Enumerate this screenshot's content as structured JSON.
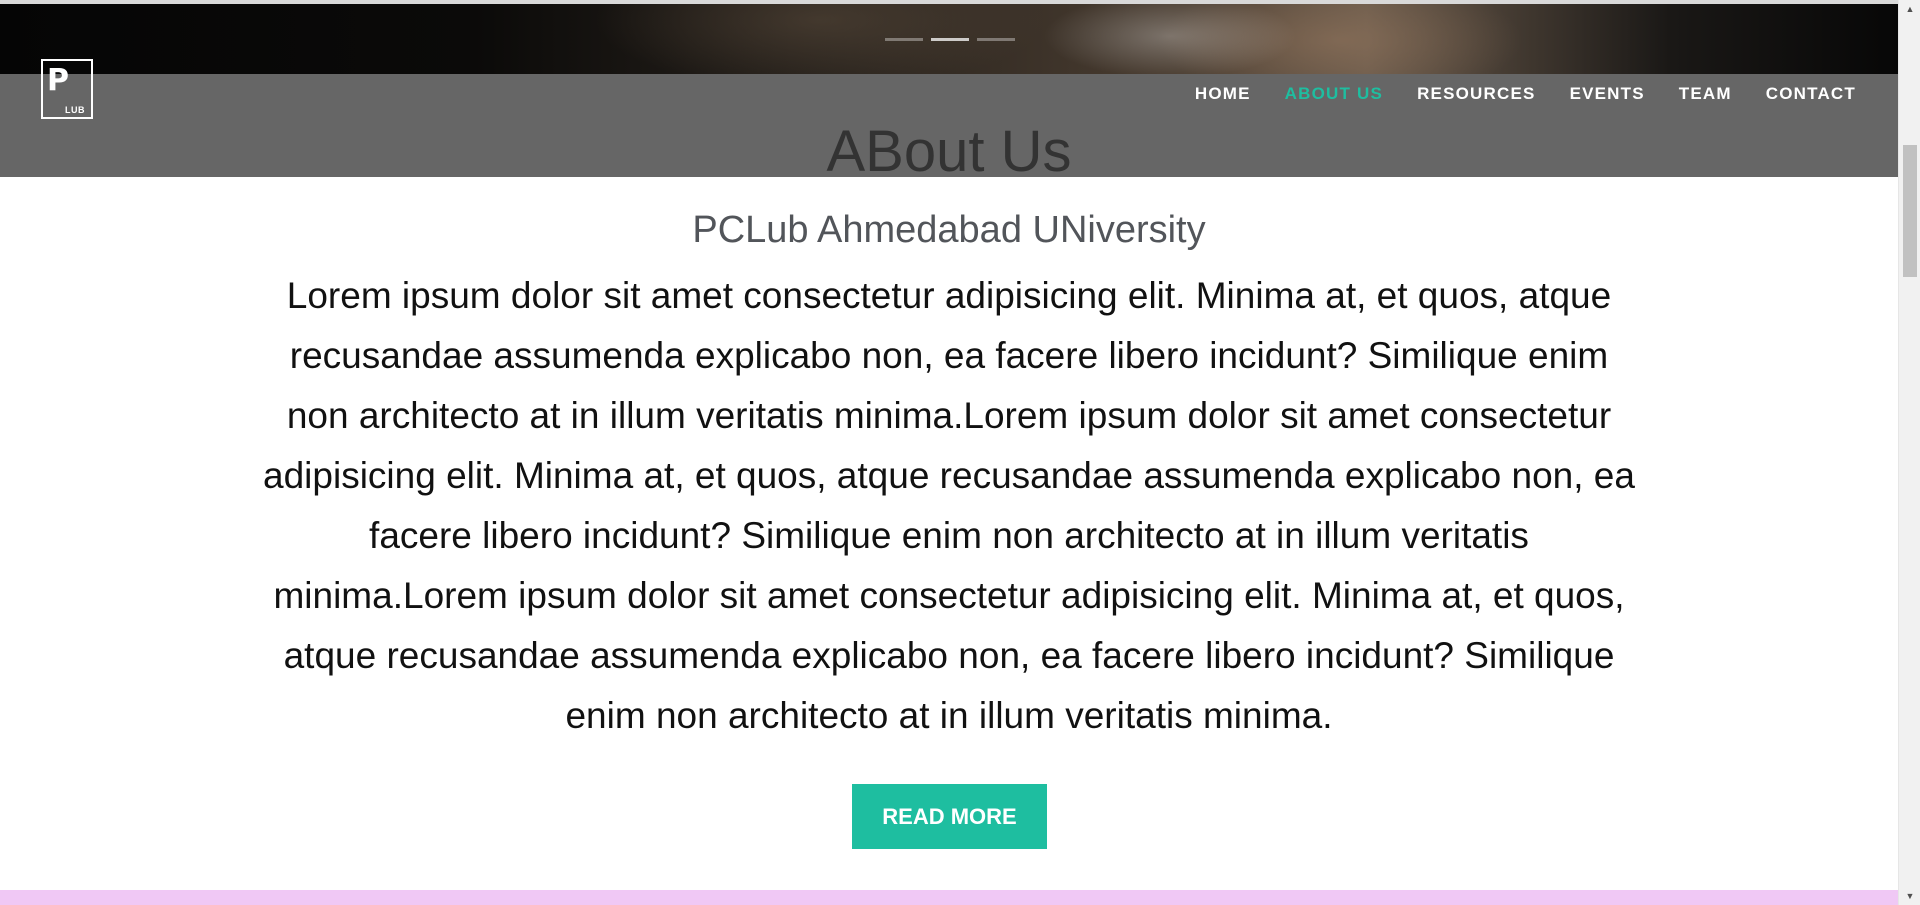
{
  "hero": {
    "carousel": {
      "indicator_count": 3,
      "active_index": 1
    }
  },
  "navbar": {
    "logo": {
      "mark": "P",
      "text": "LUB"
    },
    "links": [
      {
        "label": "HOME",
        "active": false
      },
      {
        "label": "ABOUT US",
        "active": true
      },
      {
        "label": "RESOURCES",
        "active": false
      },
      {
        "label": "EVENTS",
        "active": false
      },
      {
        "label": "TEAM",
        "active": false
      },
      {
        "label": "CONTACT",
        "active": false
      }
    ]
  },
  "about": {
    "title": "ABout Us",
    "subtitle": "PCLub Ahmedabad UNiversity",
    "body": "Lorem ipsum dolor sit amet consectetur adipisicing elit. Minima at, et quos, atque recusandae assumenda explicabo non, ea facere libero incidunt? Similique enim non architecto at in illum veritatis minima.Lorem ipsum dolor sit amet consectetur adipisicing elit. Minima at, et quos, atque recusandae assumenda explicabo non, ea facere libero incidunt? Similique enim non architecto at in illum veritatis minima.Lorem ipsum dolor sit amet consectetur adipisicing elit. Minima at, et quos, atque recusandae assumenda explicabo non, ea facere libero incidunt? Similique enim non architecto at in illum veritatis minima.",
    "button_label": "READ MORE"
  },
  "colors": {
    "accent": "#1ebea0",
    "navbar_bg": "#666666",
    "next_section_bg": "#f0c8f5"
  },
  "icons": {
    "scroll_up": "triangle-up-icon",
    "scroll_down": "triangle-down-icon"
  }
}
